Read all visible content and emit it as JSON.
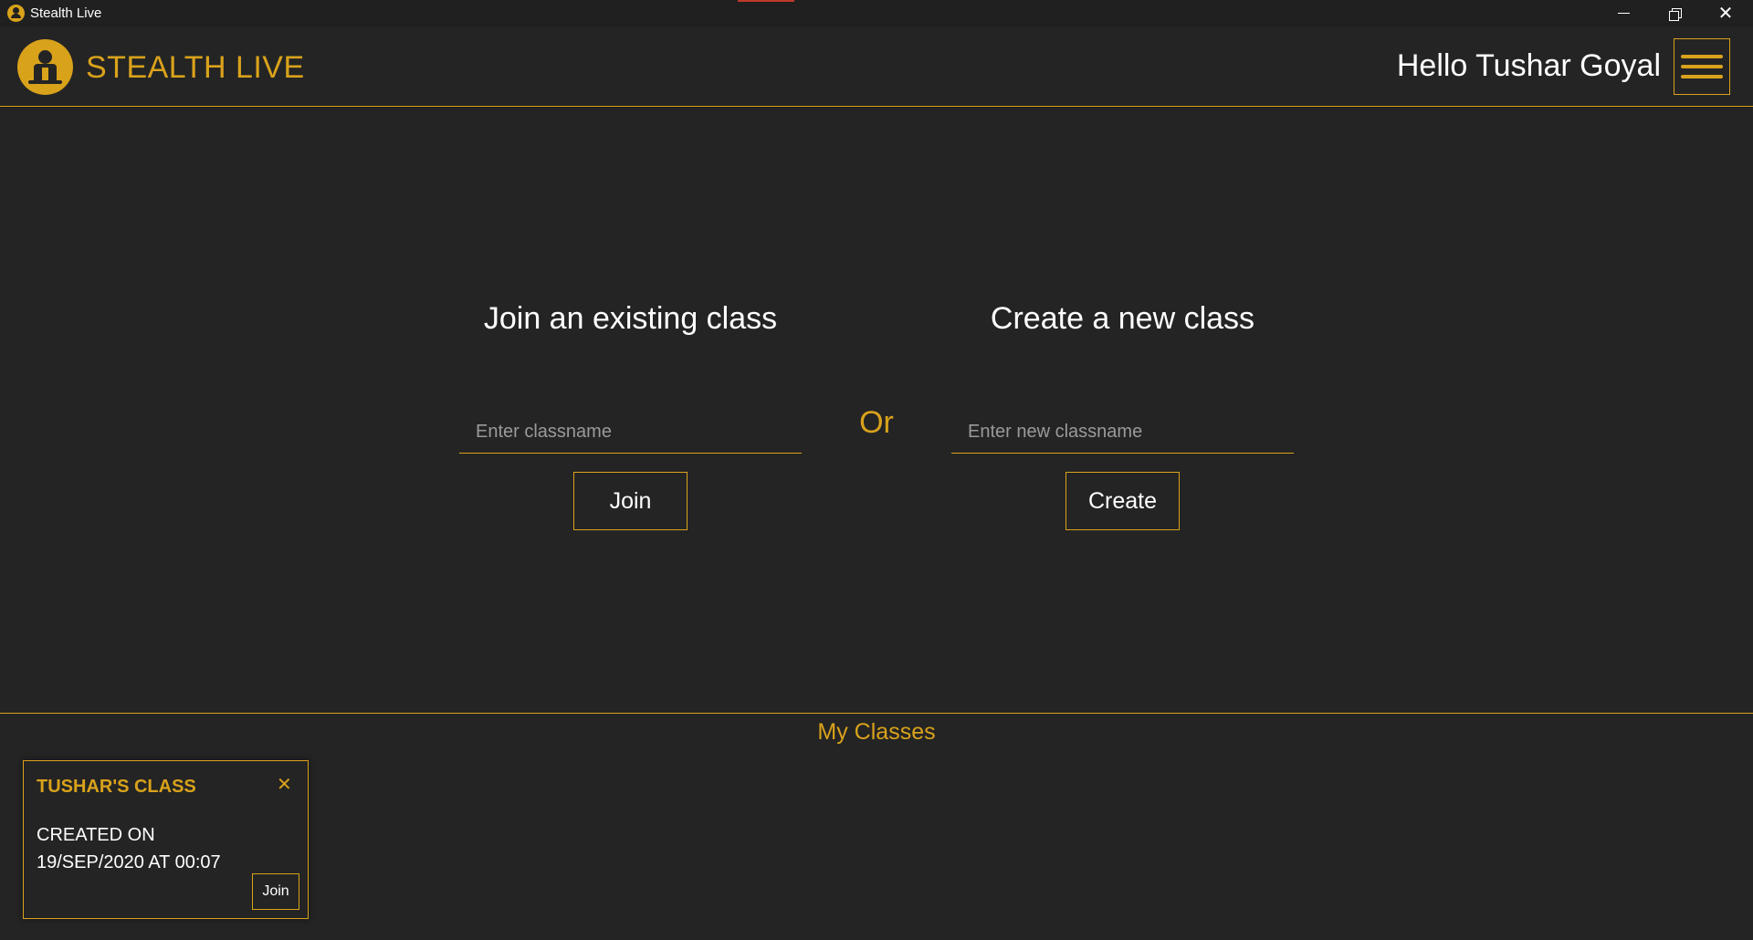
{
  "window": {
    "title": "Stealth Live",
    "controls": {
      "minimize": "minimize",
      "maximize": "restore",
      "close": "✕"
    }
  },
  "header": {
    "brand": "STEALTH LIVE",
    "greeting": "Hello Tushar Goyal",
    "menu_icon": "hamburger-menu-icon"
  },
  "join": {
    "heading": "Join an existing class",
    "placeholder": "Enter classname",
    "value": "",
    "button_label": "Join"
  },
  "separator": "Or",
  "create": {
    "heading": "Create a new class",
    "placeholder": "Enter new classname",
    "value": "",
    "button_label": "Create"
  },
  "my_classes": {
    "title": "My Classes",
    "classes": [
      {
        "name": "TUSHAR'S CLASS",
        "close_label": "✕",
        "created_label": "CREATED ON",
        "created_date": "19/SEP/2020 AT 00:07",
        "join_label": "Join"
      }
    ]
  },
  "colors": {
    "accent": "#d9a21b",
    "background": "#242424",
    "titlebar": "#202020",
    "text": "#ffffff",
    "placeholder": "#9a9a9a"
  }
}
